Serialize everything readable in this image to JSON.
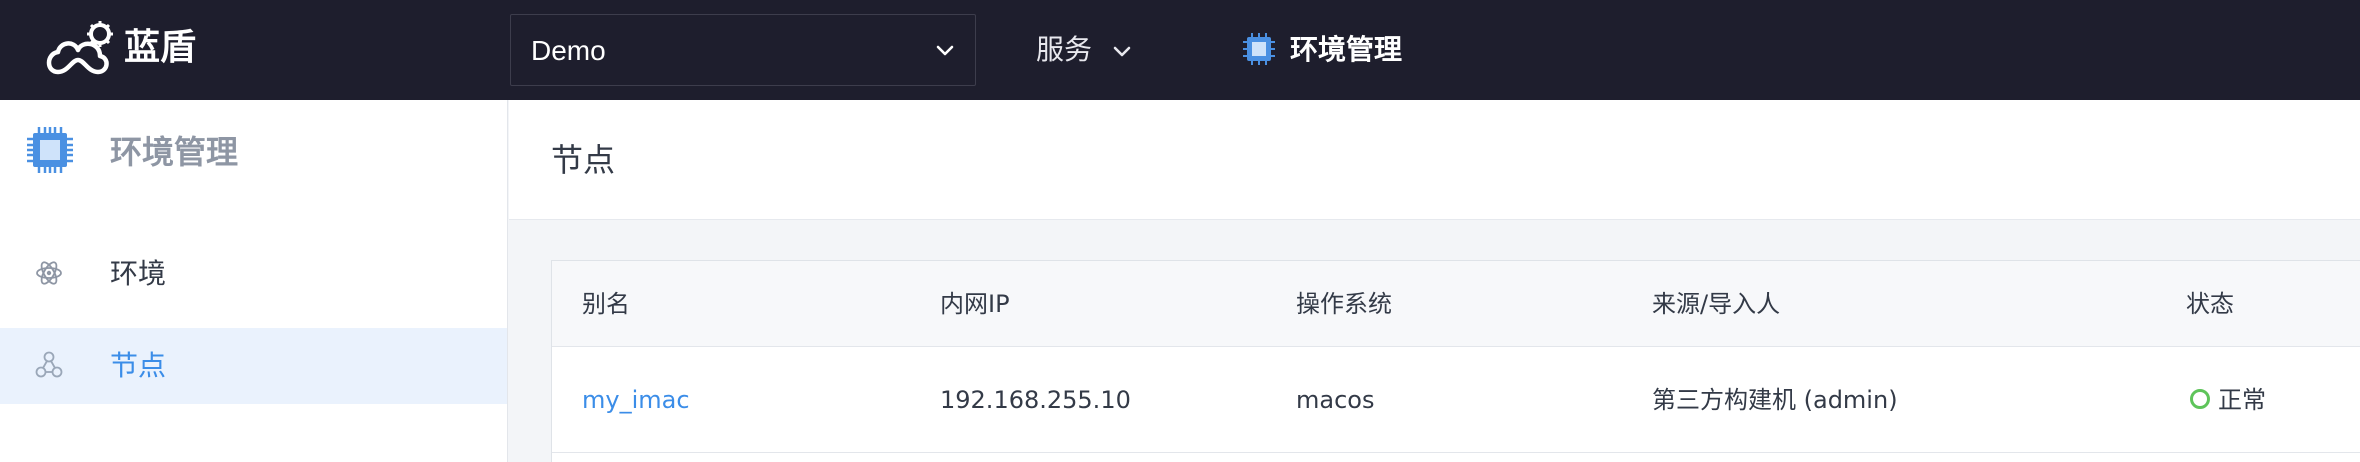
{
  "app": {
    "brand": "蓝盾",
    "project_select": {
      "value": "Demo"
    },
    "nav": {
      "services_label": "服务",
      "env_label": "环境管理"
    }
  },
  "sidebar": {
    "title": "环境管理",
    "items": [
      {
        "label": "环境",
        "icon": "atom-icon",
        "active": false
      },
      {
        "label": "节点",
        "icon": "nodes-icon",
        "active": true
      }
    ]
  },
  "main": {
    "title": "节点",
    "table": {
      "columns": [
        "别名",
        "内网IP",
        "操作系统",
        "来源/导入人",
        "状态"
      ],
      "rows": [
        {
          "alias": "my_imac",
          "ip": "192.168.255.10",
          "os": "macos",
          "source": "第三方构建机 (admin)",
          "status": "正常"
        }
      ]
    }
  },
  "colors": {
    "topbar_bg": "#1e1e2d",
    "accent": "#3b8de8",
    "active_item_bg": "#eaf2fd",
    "status_ok": "#5ec45a"
  }
}
